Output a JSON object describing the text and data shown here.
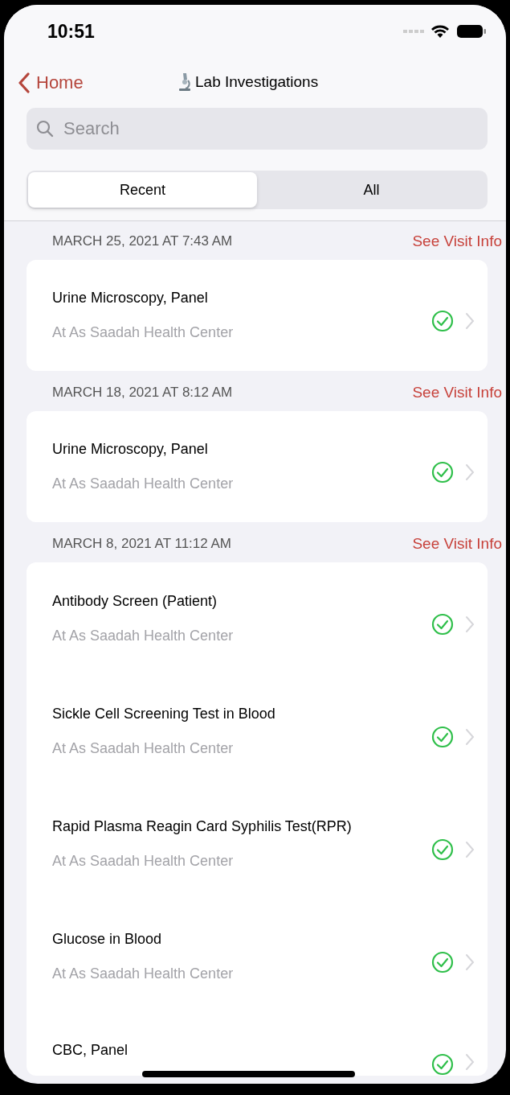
{
  "status_bar": {
    "time": "10:51"
  },
  "nav": {
    "back": "Home",
    "title": "Lab Investigations"
  },
  "search": {
    "placeholder": "Search"
  },
  "tabs": [
    {
      "label": "Recent",
      "selected": true
    },
    {
      "label": "All",
      "selected": false
    }
  ],
  "visits": [
    {
      "date": "MARCH 25, 2021 AT 7:43 AM",
      "link": "See Visit Info",
      "tests": [
        {
          "name": "Urine Microscopy, Panel",
          "place": "At As Saadah Health Center",
          "completed": true
        }
      ]
    },
    {
      "date": "MARCH 18, 2021 AT 8:12 AM",
      "link": "See Visit Info",
      "tests": [
        {
          "name": "Urine Microscopy, Panel",
          "place": "At As Saadah Health Center",
          "completed": true
        }
      ]
    },
    {
      "date": "MARCH 8, 2021 AT 11:12 AM",
      "link": "See Visit Info",
      "tests": [
        {
          "name": "Antibody Screen (Patient)",
          "place": "At As Saadah Health Center",
          "completed": true
        },
        {
          "name": "Sickle Cell Screening Test in Blood",
          "place": "At As Saadah Health Center",
          "completed": true
        },
        {
          "name": "Rapid Plasma Reagin Card Syphilis Test(RPR)",
          "place": "At As Saadah Health Center",
          "completed": true
        },
        {
          "name": "Glucose in Blood",
          "place": "At As Saadah Health Center",
          "completed": true
        },
        {
          "name": "CBC, Panel",
          "completed": true
        }
      ]
    }
  ]
}
